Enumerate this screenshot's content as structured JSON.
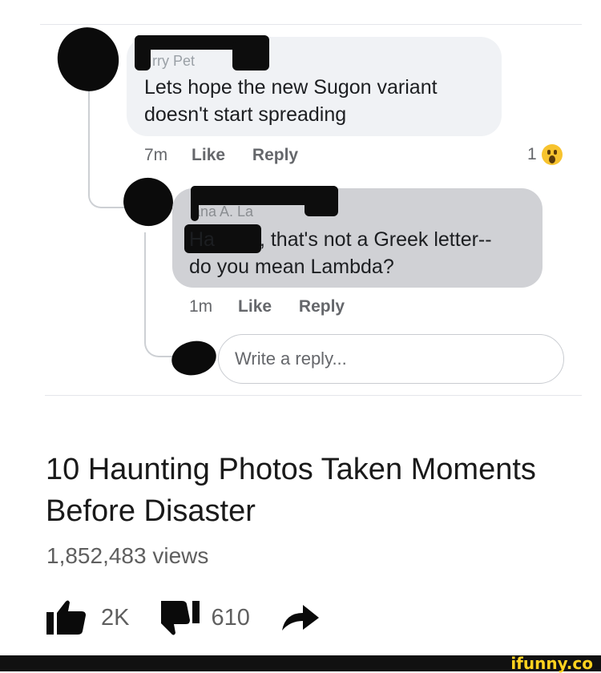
{
  "comments": [
    {
      "author": "rry Pet",
      "text": "Lets hope the new Sugon variant doesn't start spreading",
      "time": "7m",
      "like_label": "Like",
      "reply_label": "Reply",
      "reaction_count": "1",
      "reaction_icon": "wow-emoji-icon"
    },
    {
      "author": "ana A. La",
      "text_prefix": "Ha",
      "text_line1": ", that's not a Greek letter--",
      "text_line2": "do you mean Lambda?",
      "time": "1m",
      "like_label": "Like",
      "reply_label": "Reply"
    }
  ],
  "reply_box": {
    "placeholder": "Write a reply..."
  },
  "video": {
    "title": "10 Haunting Photos Taken Moments Before Disaster",
    "views": "1,852,483 views",
    "likes": "2K",
    "dislikes": "610"
  },
  "watermark": "ifunny.co",
  "colors": {
    "bubble_1": "#f0f2f5",
    "bubble_2": "#d0d1d5",
    "meta_text": "#65676b",
    "reaction": "#f7c32e",
    "watermark": "#ffd21f"
  }
}
